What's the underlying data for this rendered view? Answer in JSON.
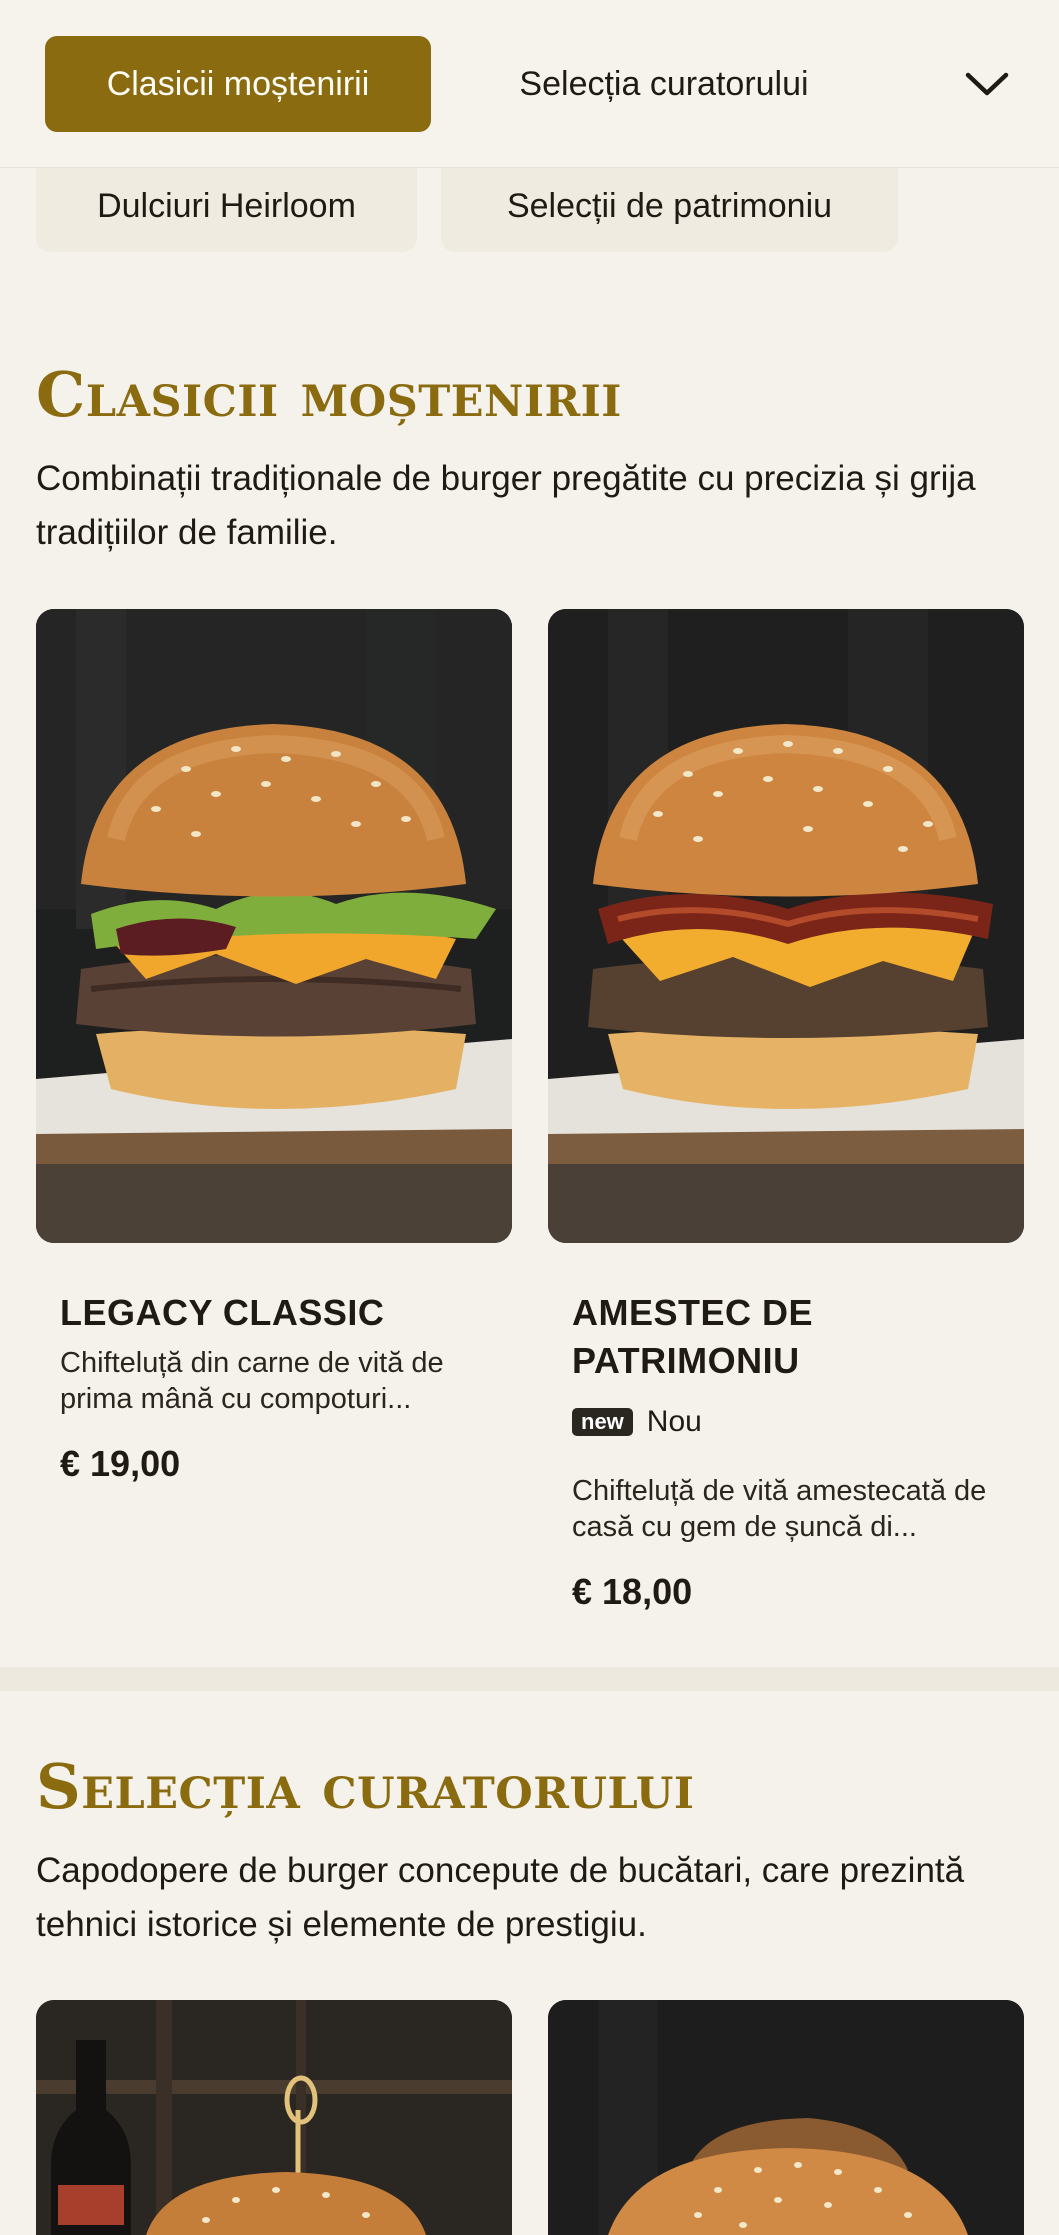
{
  "nav": {
    "tabs": [
      {
        "label": "Clasicii moștenirii",
        "active": true
      },
      {
        "label": "Selecția curatorului",
        "active": false
      }
    ],
    "expand_icon": "chevron-down-icon",
    "chips": [
      {
        "label": "Dulciuri Heirloom"
      },
      {
        "label": "Selecții de patrimoniu"
      }
    ]
  },
  "sections": [
    {
      "title": "Clasicii moștenirii",
      "description": "Combinații tradiționale de burger pregătite cu precizia și grija tradițiilor de familie.",
      "items": [
        {
          "name": "LEGACY CLASSIC",
          "description": "Chifteluță din carne de vită de prima mână cu compoturi...",
          "price": "€ 19,00",
          "image": "burger-with-lettuce-cheese-onion-jam"
        },
        {
          "name": "AMESTEC DE PATRIMONIU",
          "badge": "new",
          "badge_label": "Nou",
          "description": "Chifteluță de vită amestecată de casă cu gem de șuncă di...",
          "price": "€ 18,00",
          "image": "burger-with-bacon-cheese"
        }
      ]
    },
    {
      "title": "Selecția curatorului",
      "description": "Capodopere de burger concepute de bucătari, care prezintă tehnici istorice și elemente de prestigiu.",
      "items": [
        {
          "image": "burger-with-skewer-and-bottle"
        },
        {
          "image": "burger-sesame-bun-dark"
        }
      ]
    }
  ],
  "colors": {
    "accent": "#8a6b10",
    "background": "#f5f2eb",
    "chip": "#efebe1",
    "text": "#1f1b14"
  }
}
